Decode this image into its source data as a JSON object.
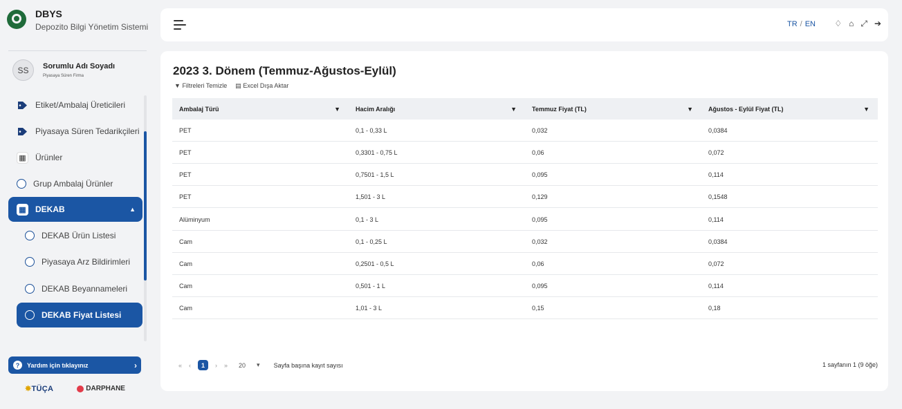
{
  "brand": {
    "title": "DBYS",
    "subtitle": "Depozito Bilgi Yönetim Sistemi"
  },
  "user": {
    "initials": "SS",
    "name": "Sorumlu Adı Soyadı",
    "role": "Piyasaya Süren Firma"
  },
  "sidebar": {
    "items": [
      {
        "label": "Etiket/Ambalaj Üreticileri",
        "icon": "tag-icon"
      },
      {
        "label": "Piyasaya Süren Tedarikçileri",
        "icon": "tag-icon"
      },
      {
        "label": "Ürünler",
        "icon": "cubes-icon"
      },
      {
        "label": "Grup Ambalaj Ürünler",
        "icon": "circle-icon"
      },
      {
        "label": "DEKAB",
        "icon": "cubes-icon"
      },
      {
        "label": "DEKAB Ürün Listesi",
        "icon": "circle-icon"
      },
      {
        "label": "Piyasaya Arz Bildirimleri",
        "icon": "circle-icon"
      },
      {
        "label": "DEKAB Beyannameleri",
        "icon": "circle-icon"
      },
      {
        "label": "DEKAB Fiyat Listesi",
        "icon": "circle-icon"
      }
    ]
  },
  "help": {
    "label": "Yardım için tıklayınız"
  },
  "partners": {
    "tuca": "TÜÇA",
    "darphane": "DARPHANE"
  },
  "topbar": {
    "lang_tr": "TR",
    "lang_sep": "/",
    "lang_en": "EN"
  },
  "page": {
    "title": "2023 3. Dönem (Temmuz-Ağustos-Eylül)",
    "clear_filters": "Filtreleri Temizle",
    "export_excel": "Excel Dışa Aktar"
  },
  "table": {
    "columns": [
      "Ambalaj Türü",
      "Hacim Aralığı",
      "Temmuz Fiyat (TL)",
      "Ağustos - Eylül Fiyat (TL)"
    ],
    "rows": [
      [
        "PET",
        "0,1 - 0,33 L",
        "0,032",
        "0,0384"
      ],
      [
        "PET",
        "0,3301 - 0,75 L",
        "0,06",
        "0,072"
      ],
      [
        "PET",
        "0,7501 - 1,5 L",
        "0,095",
        "0,114"
      ],
      [
        "PET",
        "1,501 - 3 L",
        "0,129",
        "0,1548"
      ],
      [
        "Alüminyum",
        "0,1 - 3 L",
        "0,095",
        "0,114"
      ],
      [
        "Cam",
        "0,1 - 0,25 L",
        "0,032",
        "0,0384"
      ],
      [
        "Cam",
        "0,2501 - 0,5 L",
        "0,06",
        "0,072"
      ],
      [
        "Cam",
        "0,501 - 1 L",
        "0,095",
        "0,114"
      ],
      [
        "Cam",
        "1,01 - 3 L",
        "0,15",
        "0,18"
      ]
    ]
  },
  "pager": {
    "current": "1",
    "page_size": "20",
    "page_size_label": "Sayfa başına kayıt sayısı",
    "info": "1 sayfanın 1 (9 öğe)"
  },
  "colors": {
    "primary": "#1b56a4",
    "background": "#f2f3f5"
  }
}
